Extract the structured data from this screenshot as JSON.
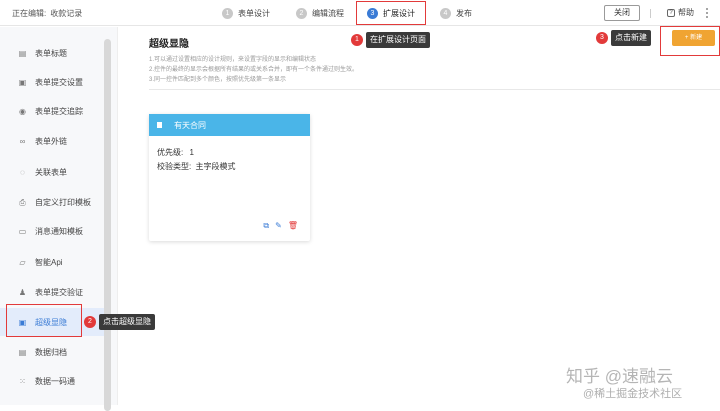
{
  "header": {
    "editing_label": "正在编辑:",
    "form_name": "收款记录",
    "steps": [
      {
        "num": "1",
        "label": "表单设计"
      },
      {
        "num": "2",
        "label": "编辑流程"
      },
      {
        "num": "3",
        "label": "扩展设计"
      },
      {
        "num": "4",
        "label": "发布"
      }
    ],
    "close_label": "关闭",
    "help_label": "帮助"
  },
  "sidebar": {
    "items": [
      {
        "label": "表单标题",
        "icon": "form-title-icon"
      },
      {
        "label": "表单提交设置",
        "icon": "submit-settings-icon"
      },
      {
        "label": "表单提交追踪",
        "icon": "eye-icon"
      },
      {
        "label": "表单外链",
        "icon": "link-icon"
      },
      {
        "label": "关联表单",
        "icon": "related-form-icon"
      },
      {
        "label": "自定义打印模板",
        "icon": "print-icon"
      },
      {
        "label": "消息通知模板",
        "icon": "message-icon"
      },
      {
        "label": "智能Api",
        "icon": "api-icon"
      },
      {
        "label": "表单提交验证",
        "icon": "user-verify-icon"
      },
      {
        "label": "超级显隐",
        "icon": "save-icon"
      },
      {
        "label": "数据归档",
        "icon": "archive-icon"
      },
      {
        "label": "数据一码通",
        "icon": "grid-icon"
      }
    ],
    "active_index": 9
  },
  "main": {
    "title": "超级显隐",
    "desc_lines": [
      "1.可以通过设置相应的设计规则，来设置字段的显示和编辑状态",
      "2.控件的最终的显示会根据所有结果的或关系合并，即有一个条件通过则生效。",
      "3.同一控件匹配到多个颜色，按照优先级第一条显示"
    ],
    "new_button": "+ 新建",
    "card": {
      "title": "有天合同",
      "priority_label": "优先级:",
      "priority_value": "1",
      "type_label": "校验类型:",
      "type_value": "主字段模式"
    }
  },
  "annotations": {
    "a1": {
      "num": "1",
      "text": "在扩展设计页面"
    },
    "a2": {
      "num": "2",
      "text": "点击超级显隐"
    },
    "a3": {
      "num": "3",
      "text": "点击新建"
    }
  },
  "watermark": {
    "line1": "知乎 @速融云",
    "line2": "@稀土掘金技术社区"
  },
  "colors": {
    "accent": "#3a7bd5",
    "card_header": "#4ab5e8",
    "new_button": "#f0a432",
    "annotation": "#e23a3a"
  }
}
